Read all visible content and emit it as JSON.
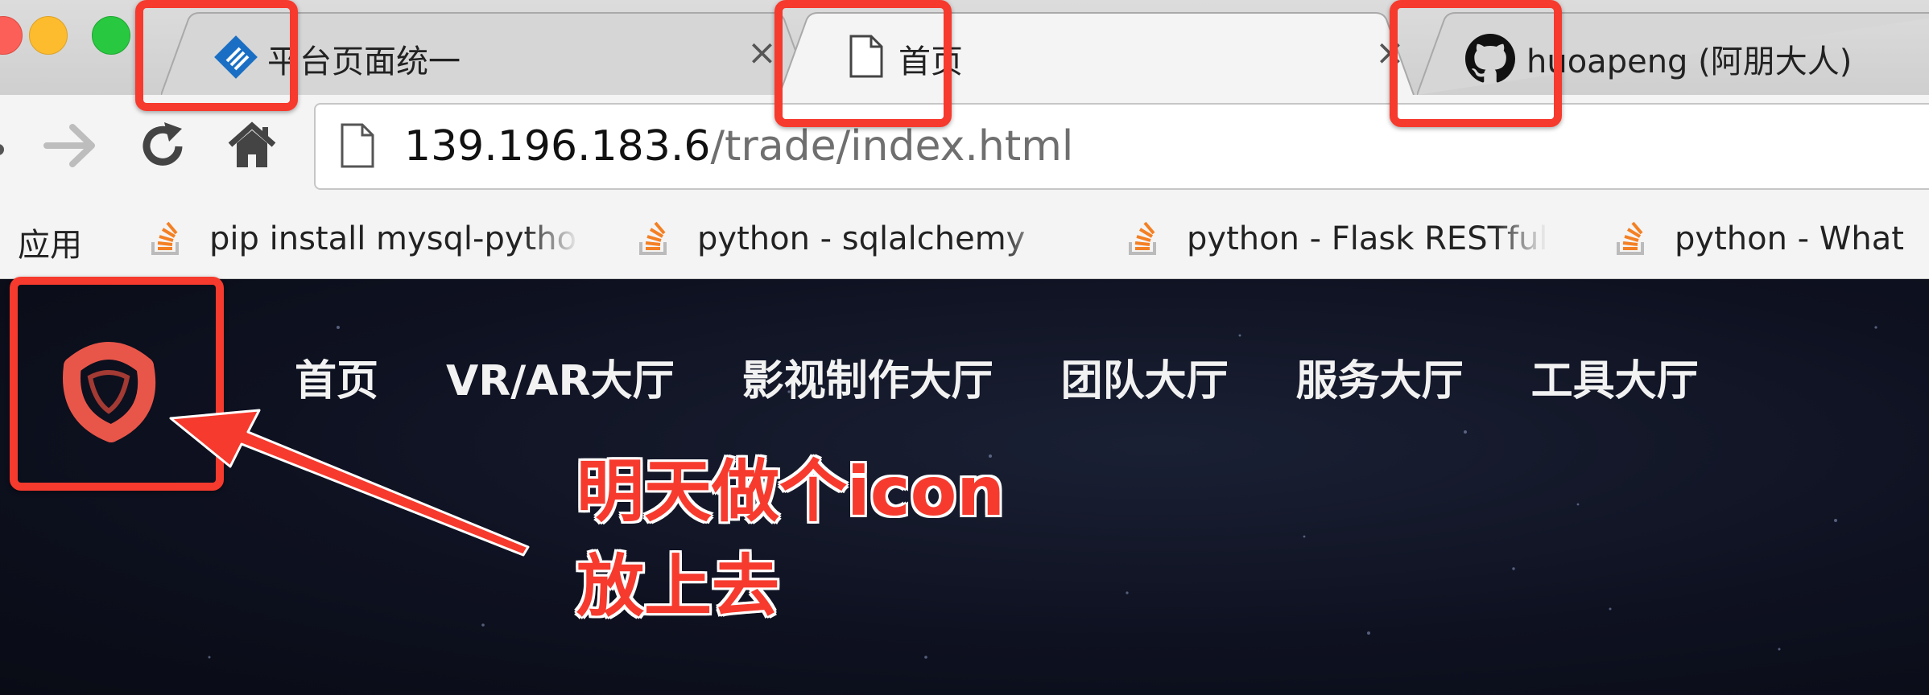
{
  "browser": {
    "tabs": [
      {
        "title": "平台页面统一",
        "icon": "diamond-site-icon",
        "active": false
      },
      {
        "title": "首页",
        "icon": "page-icon",
        "active": true
      },
      {
        "title": "huoapeng (阿朋大人)",
        "icon": "github-icon",
        "active": false
      }
    ],
    "tab_close_glyph": "×",
    "address": {
      "host": "139.196.183.6",
      "path": "/trade/index.html"
    },
    "bookmarks": {
      "apps_label": "应用",
      "items": [
        {
          "label": "pip install mysql-python",
          "icon": "stackoverflow-icon"
        },
        {
          "label": "python - sqlalchemy",
          "icon": "stackoverflow-icon"
        },
        {
          "label": "python - Flask RESTful",
          "icon": "stackoverflow-icon"
        },
        {
          "label": "python - What",
          "icon": "stackoverflow-icon"
        }
      ]
    }
  },
  "site": {
    "logo": "triangle-knot-logo-icon",
    "nav": [
      "首页",
      "VR/AR大厅",
      "影视制作大厅",
      "团队大厅",
      "服务大厅",
      "工具大厅"
    ]
  },
  "annotation": {
    "line1": "明天做个icon",
    "line2": "放上去"
  },
  "colors": {
    "annotation_red": "#f63a2d",
    "page_background": "#0f1320",
    "logo_red": "#e8564a"
  }
}
